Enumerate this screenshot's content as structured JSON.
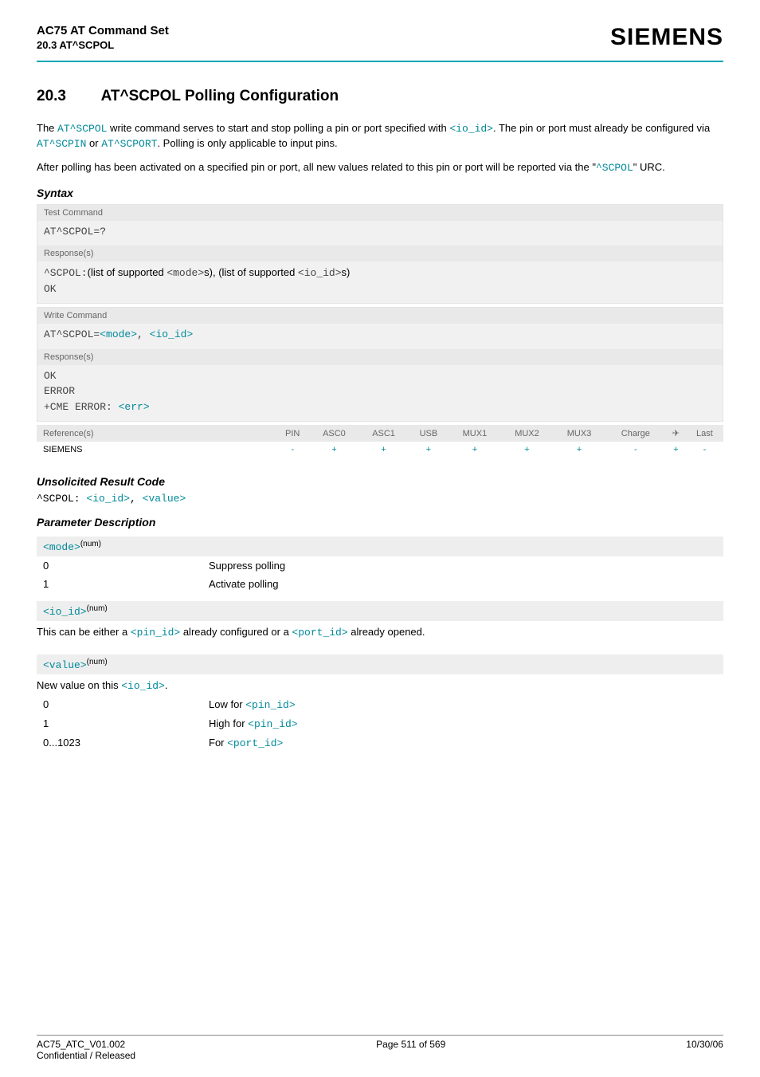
{
  "header": {
    "doc_title": "AC75 AT Command Set",
    "doc_sub": "20.3 AT^SCPOL",
    "brand": "SIEMENS"
  },
  "section": {
    "num": "20.3",
    "title": "AT^SCPOL   Polling Configuration"
  },
  "intro": {
    "p1_a": "The ",
    "p1_b": "AT^SCPOL",
    "p1_c": " write command serves to start and stop polling a pin or port specified with ",
    "p1_d": "<io_id>",
    "p1_e": ". The pin or port must already be configured via ",
    "p1_f": "AT^SCPIN",
    "p1_g": " or ",
    "p1_h": "AT^SCPORT",
    "p1_i": ". Polling is only applicable to input pins.",
    "p2_a": "After polling has been activated on a specified pin or port, all new values related to this pin or port will be reported via the \"",
    "p2_b": "^SCPOL",
    "p2_c": "\" URC."
  },
  "syntax_label": "Syntax",
  "test": {
    "bar": "Test Command",
    "cmd": "AT^SCPOL=?",
    "resp_bar": "Response(s)",
    "resp_a": "^SCPOL:",
    "resp_b": "(list of supported ",
    "resp_c": "<mode>",
    "resp_d": "s), (list of supported ",
    "resp_e": "<io_id>",
    "resp_f": "s)",
    "ok": "OK"
  },
  "write": {
    "bar": "Write Command",
    "cmd_a": "AT^SCPOL=",
    "cmd_b": "<mode>",
    "cmd_c": ", ",
    "cmd_d": "<io_id>",
    "resp_bar": "Response(s)",
    "ok": "OK",
    "err1": "ERROR",
    "err2_a": "+CME ERROR: ",
    "err2_b": "<err>"
  },
  "ref": {
    "head_lbl": "Reference(s)",
    "cols": [
      "PIN",
      "ASC0",
      "ASC1",
      "USB",
      "MUX1",
      "MUX2",
      "MUX3",
      "Charge",
      "✈",
      "Last"
    ],
    "row_lbl": "SIEMENS",
    "row_vals": [
      "-",
      "+",
      "+",
      "+",
      "+",
      "+",
      "+",
      "-",
      "+",
      "-"
    ]
  },
  "urc": {
    "label": "Unsolicited Result Code",
    "a": "^SCPOL: ",
    "b": "<io_id>",
    "c": ", ",
    "d": "<value>"
  },
  "pd_label": "Parameter Description",
  "mode": {
    "name": "<mode>",
    "sup": "(num)",
    "r0k": "0",
    "r0v": "Suppress polling",
    "r1k": "1",
    "r1v": "Activate polling"
  },
  "ioid": {
    "name": "<io_id>",
    "sup": "(num)",
    "desc_a": "This can be either a ",
    "desc_b": "<pin_id>",
    "desc_c": " already configured or a ",
    "desc_d": "<port_id>",
    "desc_e": " already opened."
  },
  "value": {
    "name": "<value>",
    "sup": "(num)",
    "desc_a": "New value on this ",
    "desc_b": "<io_id>",
    "desc_c": ".",
    "r0k": "0",
    "r0v_a": "Low for ",
    "r0v_b": "<pin_id>",
    "r1k": "1",
    "r1v_a": "High for ",
    "r1v_b": "<pin_id>",
    "r2k": "0...1023",
    "r2v_a": "For ",
    "r2v_b": "<port_id>"
  },
  "footer": {
    "left1": "AC75_ATC_V01.002",
    "left2": "Confidential / Released",
    "center": "Page 511 of 569",
    "right": "10/30/06"
  }
}
